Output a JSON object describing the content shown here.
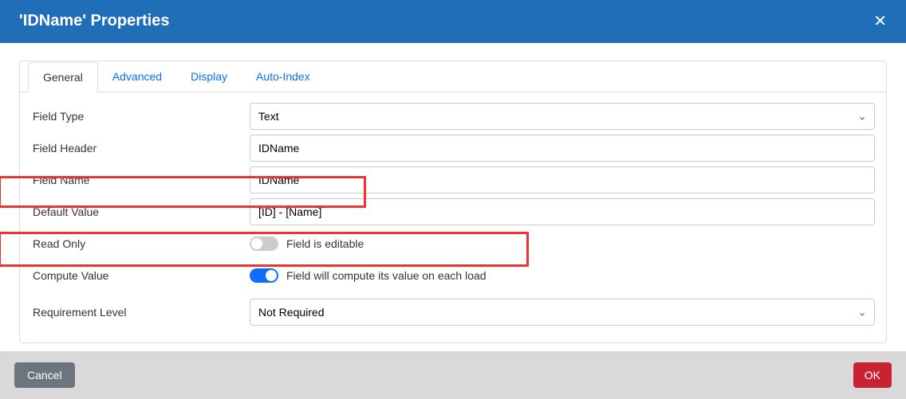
{
  "dialog": {
    "title": "'IDName' Properties",
    "close_icon": "✕"
  },
  "tabs": {
    "general": "General",
    "advanced": "Advanced",
    "display": "Display",
    "auto_index": "Auto-Index"
  },
  "labels": {
    "field_type": "Field Type",
    "field_header": "Field Header",
    "field_name": "Field Name",
    "default_value": "Default Value",
    "read_only": "Read Only",
    "compute_value": "Compute Value",
    "requirement_level": "Requirement Level"
  },
  "values": {
    "field_type": "Text",
    "field_header": "IDName",
    "field_name": "IDName",
    "default_value": "[ID] - [Name]",
    "read_only_toggle": "off",
    "read_only_text": "Field is editable",
    "compute_value_toggle": "on",
    "compute_value_text": "Field will compute its value on each load",
    "requirement_level": "Not Required"
  },
  "footer": {
    "cancel": "Cancel",
    "ok": "OK"
  }
}
